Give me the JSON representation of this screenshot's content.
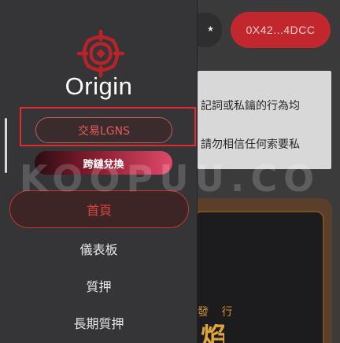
{
  "header": {
    "language_icon": "star-icon",
    "wallet_address": "0X42...4DCC"
  },
  "notice": {
    "line1": "記詞或私鑰的行為均",
    "line2": "請勿相信任何索要私"
  },
  "promo": {
    "label": "發 行",
    "big_text": "焰"
  },
  "sidebar": {
    "logo_icon": "origin-logo-icon",
    "brand": "Origin",
    "trade_button": "交易LGNS",
    "bridge_button": "跨鏈兌換",
    "nav": {
      "home": "首頁",
      "dashboard": "儀表板",
      "stake": "質押",
      "long_stake": "長期質押"
    }
  },
  "watermark": "KOOPUU.CO",
  "colors": {
    "accent_red": "#c2272d",
    "highlight_red": "#e32b2b",
    "sidebar_bg": "#353537"
  }
}
